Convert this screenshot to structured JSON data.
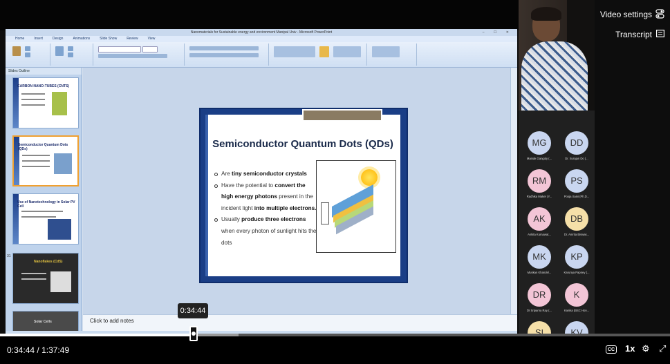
{
  "powerpoint": {
    "window_title": "Nanomaterials for Sustainable energy and environment Manipal Univ - Microsoft PowerPoint",
    "ribbon_tabs": [
      "Home",
      "Insert",
      "Design",
      "Animations",
      "Slide Show",
      "Review",
      "View"
    ],
    "panel_tabs": "Slides   Outline",
    "notes_placeholder": "Click to add notes",
    "thumbnails": [
      {
        "title": "CARBON NANO-TUBES (CNTS)"
      },
      {
        "title": "Semiconductor Quantum Dots (QDs)"
      },
      {
        "title": "Use of Nanotechnology in Solar PV Cell"
      },
      {
        "title": "Nanoflakes (CdS)"
      },
      {
        "title": "Solar Cells"
      }
    ],
    "thumbnail_numbers": [
      "31"
    ]
  },
  "slide": {
    "title": "Semiconductor Quantum Dots (QDs)",
    "bullets": [
      {
        "pre": "Are ",
        "bold": "tiny semiconductor crystals",
        "post": ""
      },
      {
        "pre": "Have the potential to ",
        "bold": "convert the high energy photons",
        "post": " present in the incident light ",
        "bold2": "into multiple electrons."
      },
      {
        "pre": "Usually ",
        "bold": "produce three electrons",
        "post": " when every photon of sunlight hits the dots"
      }
    ]
  },
  "sidebar": {
    "video_settings": "Video settings",
    "transcript": "Transcript",
    "settings_icon": "toggle-settings-icon",
    "transcript_icon": "transcript-icon"
  },
  "participants": [
    {
      "initials": "MG",
      "name": "Mainak Ganguly (...",
      "color": "#c9d6f0"
    },
    {
      "initials": "DD",
      "name": "Dr. Surajan Do (...",
      "color": "#c9d6f0"
    },
    {
      "initials": "RM",
      "name": "Radhika Maker (Y...",
      "color": "#f3c5d6"
    },
    {
      "initials": "PS",
      "name": "Pooja Saini (Ph.D...",
      "color": "#c9d6f0"
    },
    {
      "initials": "AK",
      "name": "Ankita Kumawat...",
      "color": "#f3c5d6"
    },
    {
      "initials": "DB",
      "name": "Dr. Amrita Biswas...",
      "color": "#f5dfa8"
    },
    {
      "initials": "MK",
      "name": "Muskan Khandel...",
      "color": "#c9d6f0"
    },
    {
      "initials": "KP",
      "name": "Karunya Papney (...",
      "color": "#c9d6f0"
    },
    {
      "initials": "DR",
      "name": "Dr Sriparna Ray (...",
      "color": "#f3c5d6"
    },
    {
      "initials": "K",
      "name": "Kanika (BSC Hon...",
      "color": "#f3c5d6"
    },
    {
      "initials": "SI",
      "name": "Swati Mali (Ph.D...",
      "color": "#f5dfa8"
    },
    {
      "initials": "KV",
      "name": "Khushi Verma (S...",
      "color": "#c9d6f0"
    }
  ],
  "player": {
    "tooltip_time": "0:34:44",
    "current_time": "0:34:44",
    "separator": "/",
    "duration": "1:37:49",
    "progress_fraction": 0.355,
    "buffered_fraction": 0.44,
    "cc_label": "CC",
    "speed": "1x",
    "settings_icon": "gear-icon",
    "fullscreen_icon": "expand-icon"
  }
}
